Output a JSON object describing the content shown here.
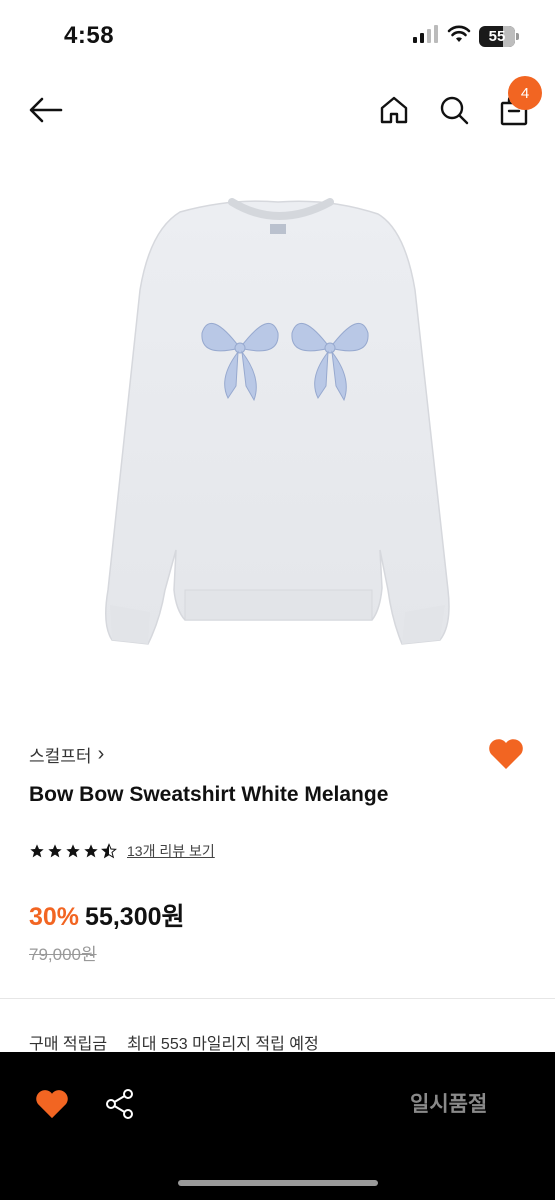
{
  "status": {
    "time": "4:58",
    "battery": "55"
  },
  "nav": {
    "cart_count": "4",
    "icons": [
      "back-arrow-icon",
      "home-icon",
      "search-icon",
      "shopping-bag-icon"
    ]
  },
  "product": {
    "brand": "스컬프터",
    "brand_chevron": "›",
    "name": "Bow Bow Sweatshirt White Melange",
    "rating": 4.5,
    "review_text": "13개 리뷰 보기",
    "discount": "30%",
    "price": "55,300원",
    "original_price": "79,000원",
    "points_label": "구매 적립금",
    "points_value": "최대 553 마일리지 적립 예정"
  },
  "bottom_bar": {
    "sold_out_label": "일시품절"
  },
  "colors": {
    "accent": "#f26522",
    "bar_bg": "#000000"
  }
}
